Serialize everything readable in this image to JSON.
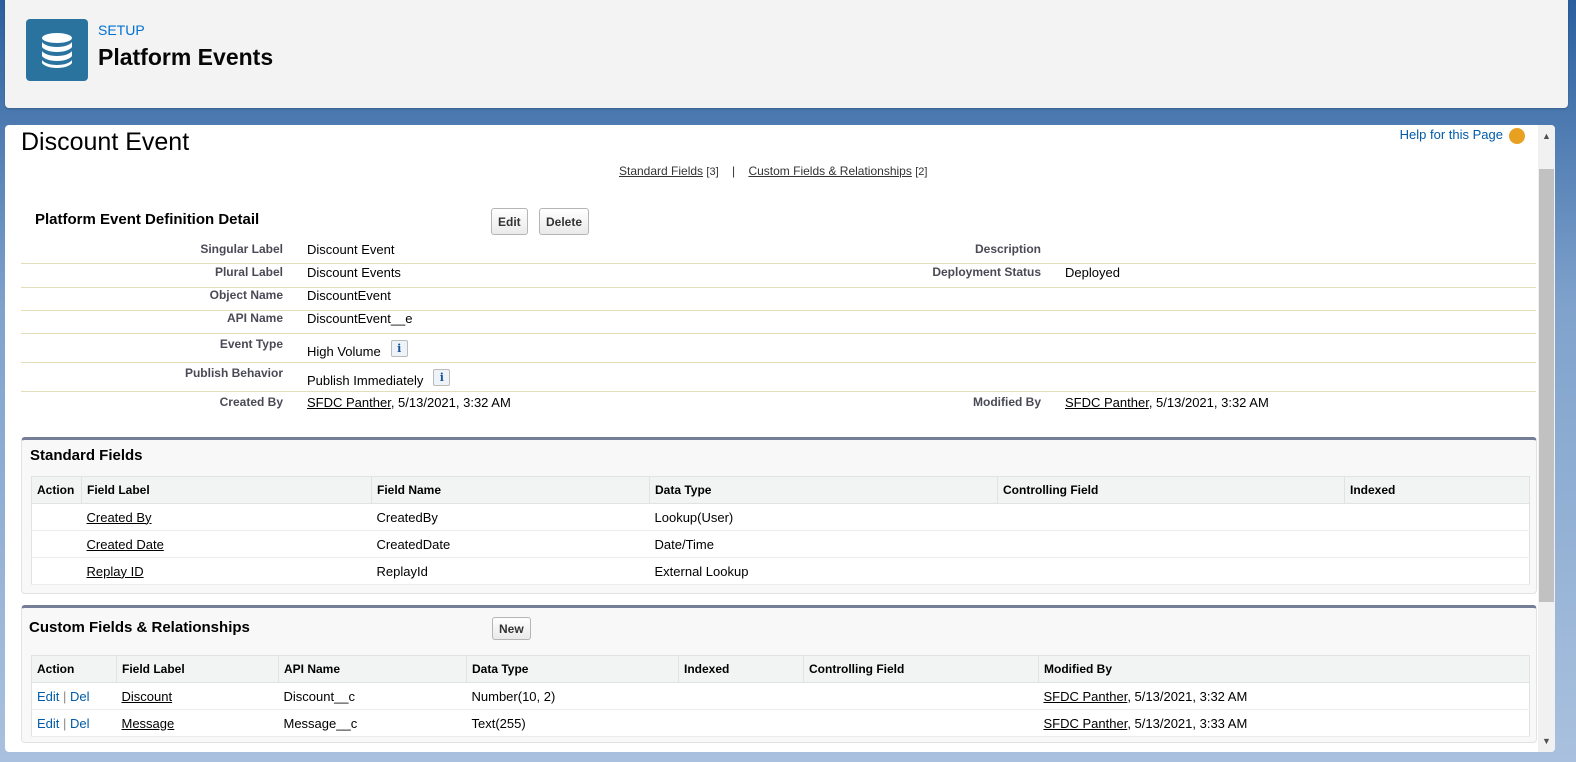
{
  "header": {
    "breadcrumb": "SETUP",
    "title": "Platform Events"
  },
  "help_link": "Help for this Page",
  "record_title": "Discount Event",
  "related_links": {
    "standard": "Standard Fields",
    "standard_count": "[3]",
    "sep": "|",
    "custom": "Custom Fields & Relationships",
    "custom_count": "[2]"
  },
  "detail": {
    "title": "Platform Event Definition Detail",
    "edit": "Edit",
    "delete": "Delete",
    "rows": [
      {
        "label": "Singular Label",
        "value": "Discount Event",
        "label2": "Description",
        "value2": ""
      },
      {
        "label": "Plural Label",
        "value": "Discount Events",
        "label2": "Deployment Status",
        "value2": "Deployed"
      },
      {
        "label": "Object Name",
        "value": "DiscountEvent"
      },
      {
        "label": "API Name",
        "value": "DiscountEvent__e"
      },
      {
        "label": "Event Type",
        "value": "High Volume"
      },
      {
        "label": "Publish Behavior",
        "value": "Publish Immediately"
      }
    ],
    "created_by": {
      "label": "Created By",
      "user": "SFDC Panther",
      "date": ", 5/13/2021, 3:32 AM"
    },
    "modified_by": {
      "label": "Modified By",
      "user": "SFDC Panther",
      "date": ", 5/13/2021, 3:32 AM"
    },
    "info_glyph": "i"
  },
  "standard_fields": {
    "title": "Standard Fields",
    "columns": [
      "Action",
      "Field Label",
      "Field Name",
      "Data Type",
      "Controlling Field",
      "Indexed"
    ],
    "rows": [
      {
        "label": "Created By",
        "name": "CreatedBy",
        "type": "Lookup(User)"
      },
      {
        "label": "Created Date",
        "name": "CreatedDate",
        "type": "Date/Time"
      },
      {
        "label": "Replay ID",
        "name": "ReplayId",
        "type": "External Lookup"
      }
    ]
  },
  "custom_fields": {
    "title": "Custom Fields & Relationships",
    "new": "New",
    "columns": [
      "Action",
      "Field Label",
      "API Name",
      "Data Type",
      "Indexed",
      "Controlling Field",
      "Modified By"
    ],
    "edit": "Edit",
    "del": "Del",
    "sep": "|",
    "rows": [
      {
        "label": "Discount",
        "api": "Discount__c",
        "type": "Number(10, 2)",
        "user": "SFDC Panther",
        "date": ", 5/13/2021, 3:32 AM"
      },
      {
        "label": "Message",
        "api": "Message__c",
        "type": "Text(255)",
        "user": "SFDC Panther",
        "date": ", 5/13/2021, 3:33 AM"
      }
    ]
  }
}
